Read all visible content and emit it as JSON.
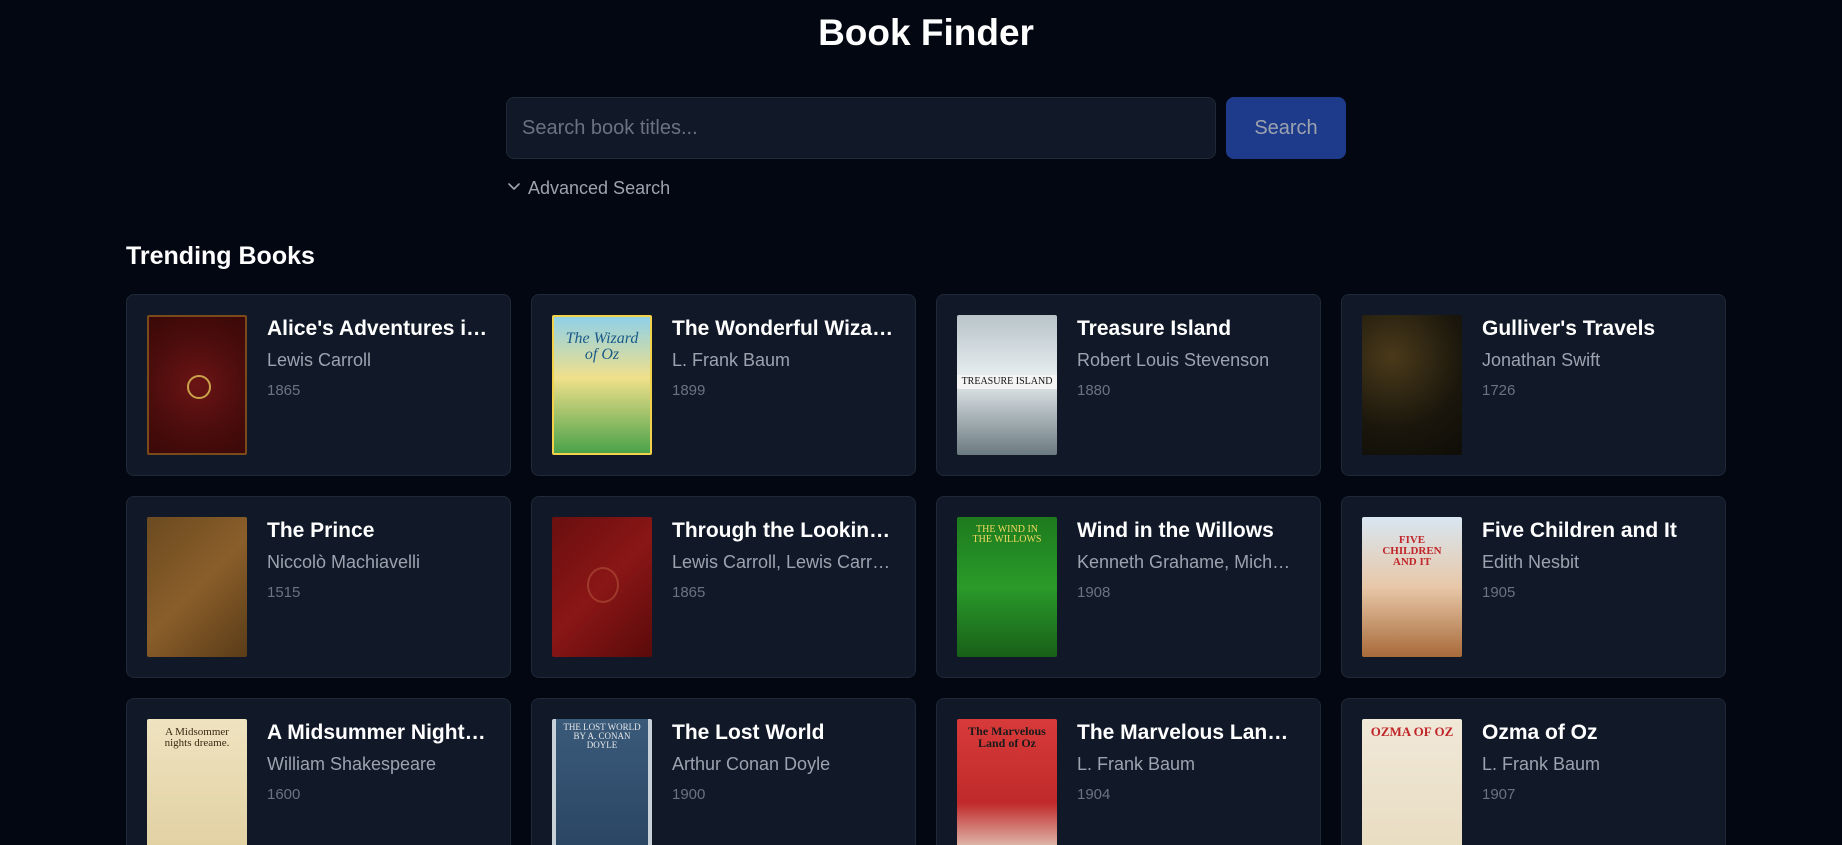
{
  "header": {
    "title": "Book Finder"
  },
  "search": {
    "placeholder": "Search book titles...",
    "button_label": "Search"
  },
  "advanced": {
    "label": "Advanced Search"
  },
  "trending": {
    "heading": "Trending Books",
    "books": [
      {
        "title": "Alice's Adventures in ...",
        "author": "Lewis Carroll",
        "year": "1865",
        "cover_text": ""
      },
      {
        "title": "The Wonderful Wizard...",
        "author": "L. Frank Baum",
        "year": "1899",
        "cover_text": "The Wizard of Oz"
      },
      {
        "title": "Treasure Island",
        "author": "Robert Louis Stevenson",
        "year": "1880",
        "cover_text": "TREASURE ISLAND"
      },
      {
        "title": "Gulliver's Travels",
        "author": "Jonathan Swift",
        "year": "1726",
        "cover_text": ""
      },
      {
        "title": "The Prince",
        "author": "Niccolò Machiavelli",
        "year": "1515",
        "cover_text": ""
      },
      {
        "title": "Through the Looking-...",
        "author": "Lewis Carroll, Lewis Carroll,...",
        "year": "1865",
        "cover_text": ""
      },
      {
        "title": "Wind in the Willows",
        "author": "Kenneth Grahame, Michael...",
        "year": "1908",
        "cover_text": "THE WIND IN THE WILLOWS"
      },
      {
        "title": "Five Children and It",
        "author": "Edith Nesbit",
        "year": "1905",
        "cover_text": "FIVE CHILDREN AND IT"
      },
      {
        "title": "A Midsummer Night's ...",
        "author": "William Shakespeare",
        "year": "1600",
        "cover_text": "A Midsommer nights dreame."
      },
      {
        "title": "The Lost World",
        "author": "Arthur Conan Doyle",
        "year": "1900",
        "cover_text": "THE LOST WORLD BY A. CONAN DOYLE"
      },
      {
        "title": "The Marvelous Land o...",
        "author": "L. Frank Baum",
        "year": "1904",
        "cover_text": "The Marvelous Land of Oz"
      },
      {
        "title": "Ozma of Oz",
        "author": "L. Frank Baum",
        "year": "1907",
        "cover_text": "OZMA OF OZ"
      }
    ]
  },
  "colors": {
    "background": "#030712",
    "card": "#111827",
    "accent": "#1e3a8a"
  }
}
